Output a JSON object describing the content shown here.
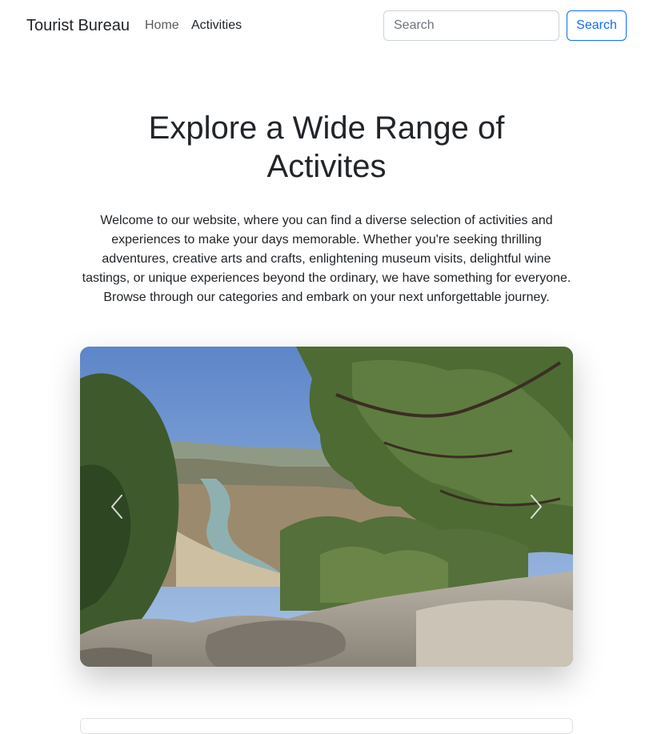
{
  "navbar": {
    "brand": "Tourist Bureau",
    "links": [
      {
        "label": "Home",
        "active": false
      },
      {
        "label": "Activities",
        "active": true
      }
    ],
    "search": {
      "placeholder": "Search",
      "value": "",
      "button_label": "Search"
    }
  },
  "hero": {
    "title_line1": "Explore a Wide Range of",
    "title_line2": "Activites",
    "description": "Welcome to our website, where you can find a diverse selection of activities and experiences to make your days memorable. Whether you're seeking thrilling adventures, creative arts and crafts, enlightening museum visits, delightful wine tastings, or unique experiences beyond the ordinary, we have something for everyone. Browse through our categories and embark on your next unforgettable journey."
  },
  "carousel": {
    "prev_icon": "chevron-left-icon",
    "next_icon": "chevron-right-icon"
  },
  "colors": {
    "primary": "#0d6efd",
    "text": "#212529",
    "muted_link": "rgba(0,0,0,0.65)"
  }
}
